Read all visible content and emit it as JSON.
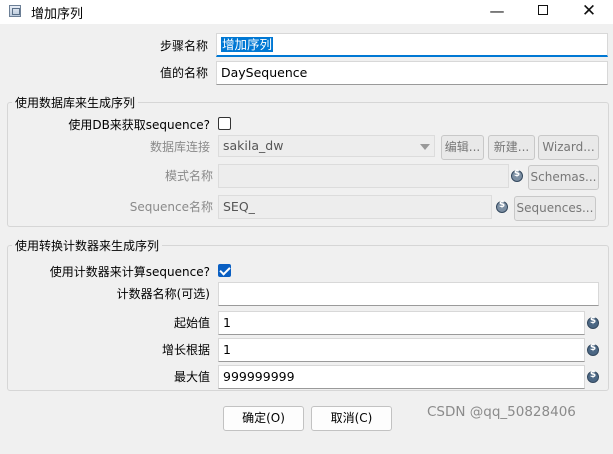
{
  "window": {
    "title": "增加序列",
    "minimize_glyph": "—",
    "close_glyph": "✕"
  },
  "step": {
    "step_name_label": "步骤名称",
    "step_name_value": "增加序列",
    "value_name_label": "值的名称",
    "value_name_value": "DaySequence"
  },
  "db_group": {
    "title": "使用数据库来生成序列",
    "use_db_label": "使用DB来获取sequence?",
    "use_db_checked": false,
    "connection_label": "数据库连接",
    "connection_value": "sakila_dw",
    "edit_button": "编辑...",
    "new_button": "新建...",
    "wizard_button": "Wizard...",
    "schema_label": "模式名称",
    "schema_value": "",
    "schemas_button": "Schemas...",
    "sequence_label": "Sequence名称",
    "sequence_value": "SEQ_",
    "sequences_button": "Sequences..."
  },
  "counter_group": {
    "title": "使用转换计数器来生成序列",
    "use_counter_label": "使用计数器来计算sequence?",
    "use_counter_checked": true,
    "counter_name_label": "计数器名称(可选)",
    "counter_name_value": "",
    "start_label": "起始值",
    "start_value": "1",
    "increment_label": "增长根据",
    "increment_value": "1",
    "max_label": "最大值",
    "max_value": "999999999"
  },
  "buttons": {
    "ok": "确定(O)",
    "cancel": "取消(C)"
  },
  "watermark": "CSDN @qq_50828406"
}
